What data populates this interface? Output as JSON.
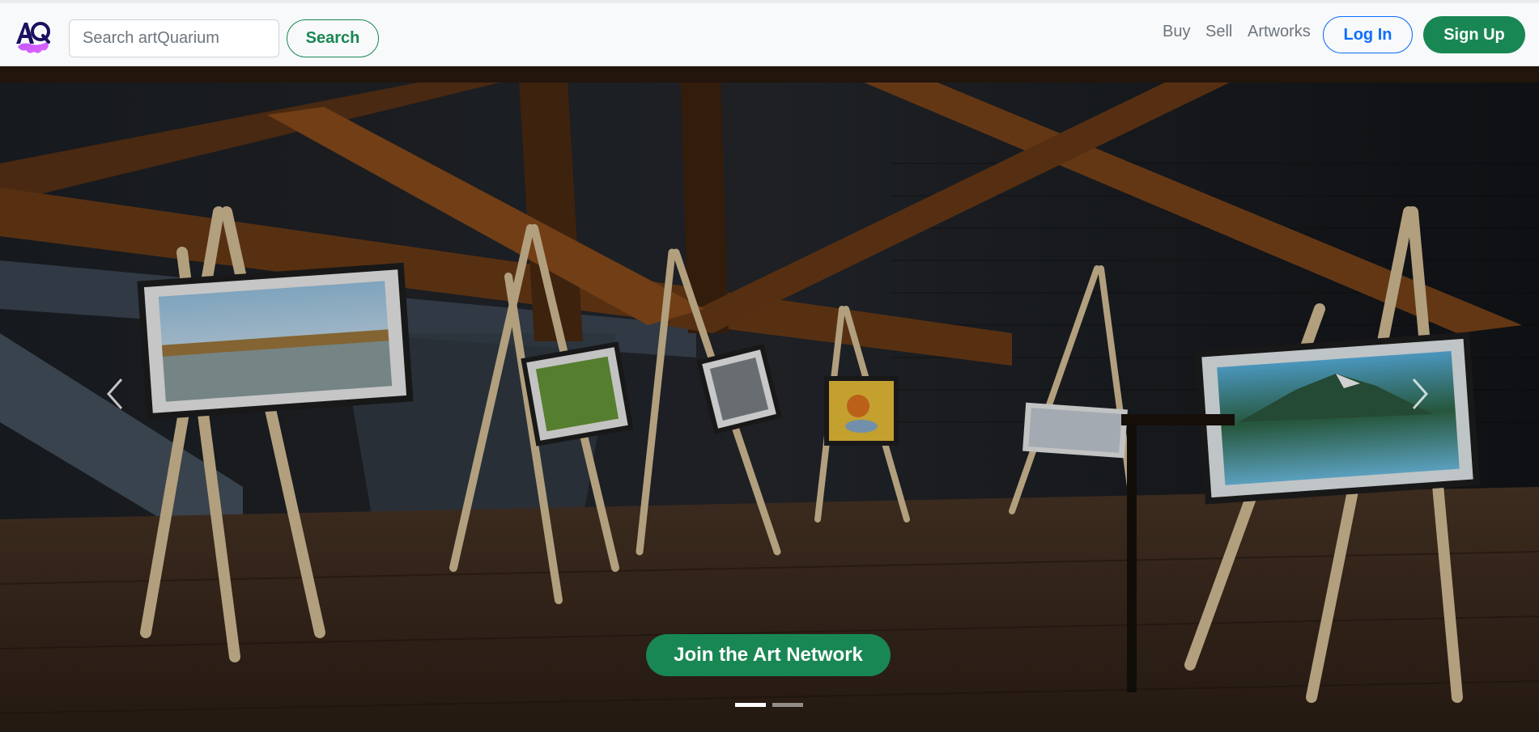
{
  "brand": {
    "name": "artQuarium",
    "logo_icon": "aq-logo-icon"
  },
  "search": {
    "placeholder": "Search artQuarium",
    "value": "",
    "button_label": "Search"
  },
  "nav": {
    "links": [
      {
        "label": "Buy"
      },
      {
        "label": "Sell"
      },
      {
        "label": "Artworks"
      }
    ],
    "login_label": "Log In",
    "signup_label": "Sign Up"
  },
  "hero": {
    "cta_label": "Join the Art Network",
    "slides_count": 2,
    "active_slide": 1,
    "prev_icon": "chevron-left-icon",
    "next_icon": "chevron-right-icon"
  },
  "colors": {
    "primary_green": "#198754",
    "primary_blue": "#0d6efd",
    "nav_bg": "#f8f9fa",
    "nav_text": "#6c757d"
  }
}
